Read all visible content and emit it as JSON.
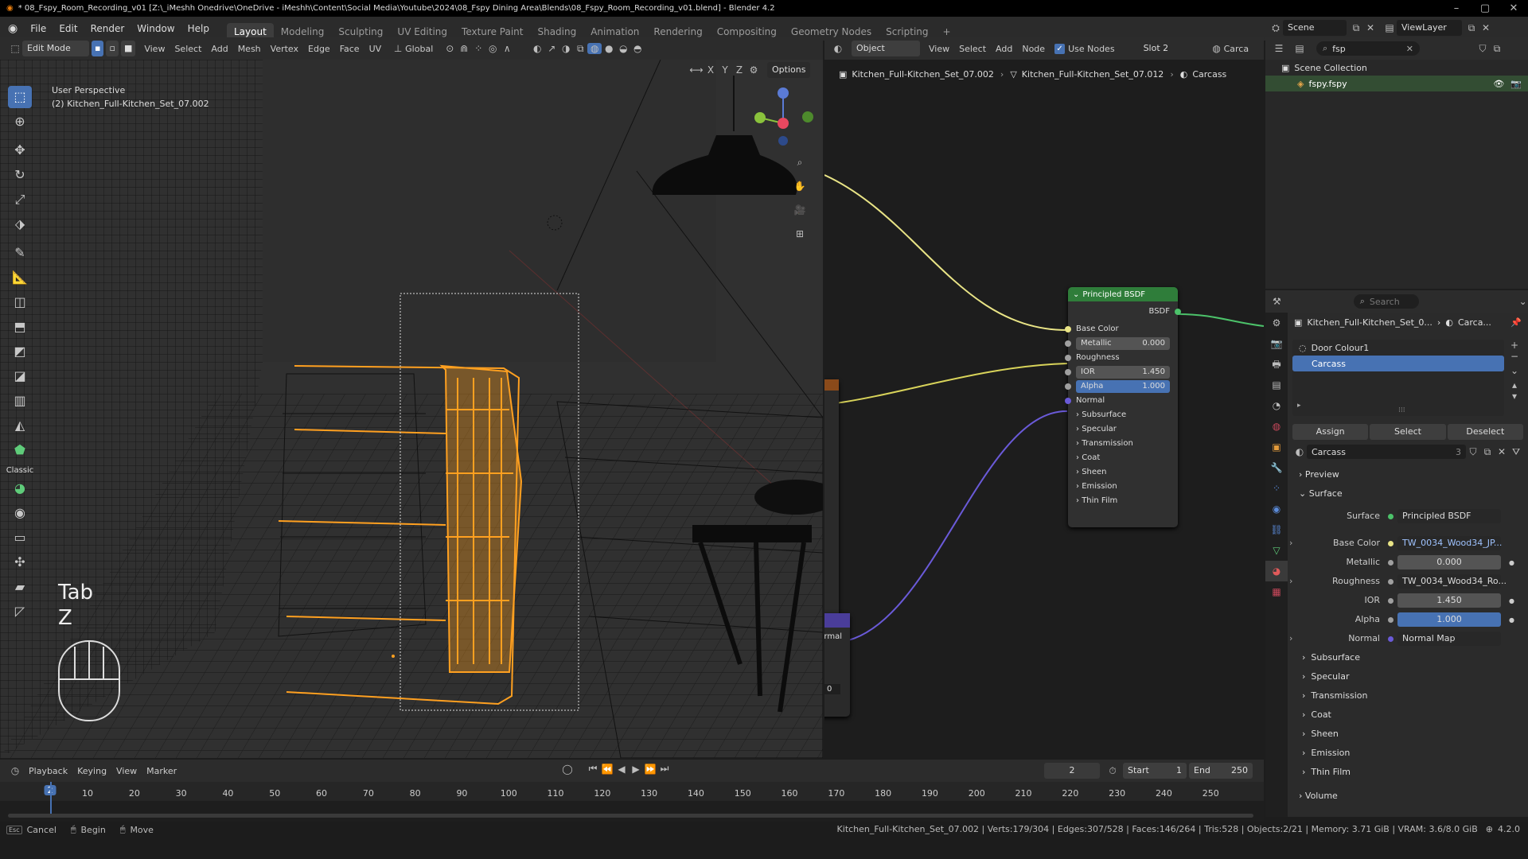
{
  "window": {
    "title": "* 08_Fspy_Room_Recording_v01 [Z:\\_iMeshh Onedrive\\OneDrive - iMeshh\\Content\\Social Media\\Youtube\\2024\\08_Fspy Dining Area\\Blends\\08_Fspy_Room_Recording_v01.blend] - Blender 4.2"
  },
  "menu": {
    "items": [
      "File",
      "Edit",
      "Render",
      "Window",
      "Help"
    ]
  },
  "workspaces": [
    "Layout",
    "Modeling",
    "Sculpting",
    "UV Editing",
    "Texture Paint",
    "Shading",
    "Animation",
    "Rendering",
    "Compositing",
    "Geometry Nodes",
    "Scripting"
  ],
  "scene": {
    "label": "Scene",
    "view_layer": "ViewLayer"
  },
  "viewport": {
    "mode": "Edit Mode",
    "menus": [
      "View",
      "Select",
      "Add",
      "Mesh",
      "Vertex",
      "Edge",
      "Face",
      "UV"
    ],
    "orientation": "Global",
    "options_label": "Options",
    "axes": [
      "X",
      "Y",
      "Z"
    ],
    "perspective": "User Perspective",
    "object_label": "(2) Kitchen_Full-Kitchen_Set_07.002",
    "key_overlay": [
      "Tab",
      "Z"
    ],
    "tool_label": "Classic"
  },
  "node_editor": {
    "object_mode": "Object",
    "menus": [
      "View",
      "Select",
      "Add",
      "Node"
    ],
    "use_nodes": "Use Nodes",
    "slot": "Slot 2",
    "material_short": "Carca",
    "breadcrumb": [
      "Kitchen_Full-Kitchen_Set_07.002",
      "Kitchen_Full-Kitchen_Set_07.012",
      "Carcass"
    ],
    "side_node_label": "rmal",
    "side_node_value": "0",
    "bsdf": {
      "title": "Principled BSDF",
      "output": "BSDF",
      "base_color": "Base Color",
      "metallic": {
        "label": "Metallic",
        "value": "0.000"
      },
      "roughness": "Roughness",
      "ior": {
        "label": "IOR",
        "value": "1.450"
      },
      "alpha": {
        "label": "Alpha",
        "value": "1.000"
      },
      "normal": "Normal",
      "panels": [
        "Subsurface",
        "Specular",
        "Transmission",
        "Coat",
        "Sheen",
        "Emission",
        "Thin Film"
      ]
    }
  },
  "outliner": {
    "search": "fsp",
    "collection": "Scene Collection",
    "item": "fspy.fspy"
  },
  "properties": {
    "search_placeholder": "Search",
    "object": "Kitchen_Full-Kitchen_Set_0...",
    "material_short": "Carca...",
    "slots": [
      "Door Colour1",
      "Carcass"
    ],
    "buttons": [
      "Assign",
      "Select",
      "Deselect"
    ],
    "material_name": "Carcass",
    "user_count": "3",
    "preview": "Preview",
    "surface_panel": "Surface",
    "surface": {
      "label": "Surface",
      "value": "Principled BSDF"
    },
    "base_color": {
      "label": "Base Color",
      "value": "TW_0034_Wood34_JP..."
    },
    "metallic": {
      "label": "Metallic",
      "value": "0.000"
    },
    "roughness": {
      "label": "Roughness",
      "value": "TW_0034_Wood34_Ro..."
    },
    "ior": {
      "label": "IOR",
      "value": "1.450"
    },
    "alpha": {
      "label": "Alpha",
      "value": "1.000"
    },
    "normal": {
      "label": "Normal",
      "value": "Normal Map"
    },
    "subpanels": [
      "Subsurface",
      "Specular",
      "Transmission",
      "Coat",
      "Sheen",
      "Emission",
      "Thin Film"
    ],
    "volume": "Volume"
  },
  "timeline": {
    "menus": [
      "Playback",
      "Keying",
      "View",
      "Marker"
    ],
    "current_frame": "2",
    "start_label": "Start",
    "start": "1",
    "end_label": "End",
    "end": "250",
    "ticks": [
      "2",
      "10",
      "20",
      "30",
      "40",
      "50",
      "60",
      "70",
      "80",
      "90",
      "100",
      "110",
      "120",
      "130",
      "140",
      "150",
      "160",
      "170",
      "180",
      "190",
      "200",
      "210",
      "220",
      "230",
      "240",
      "250"
    ]
  },
  "status": {
    "left": [
      "Cancel",
      "Begin",
      "Move"
    ],
    "stats": "Kitchen_Full-Kitchen_Set_07.002 | Verts:179/304 | Edges:307/528 | Faces:146/264 | Tris:528 | Objects:2/21 | Memory: 3.71 GiB | VRAM: 3.6/8.0 GiB",
    "version": "4.2.0"
  },
  "colors": {
    "accent": "#4772b3",
    "selection": "#ffa020",
    "bsdf_header": "#2f7d3a",
    "wire_yellow": "#e9e486",
    "wire_purple": "#6a5ad8",
    "wire_green": "#4cc26a"
  }
}
